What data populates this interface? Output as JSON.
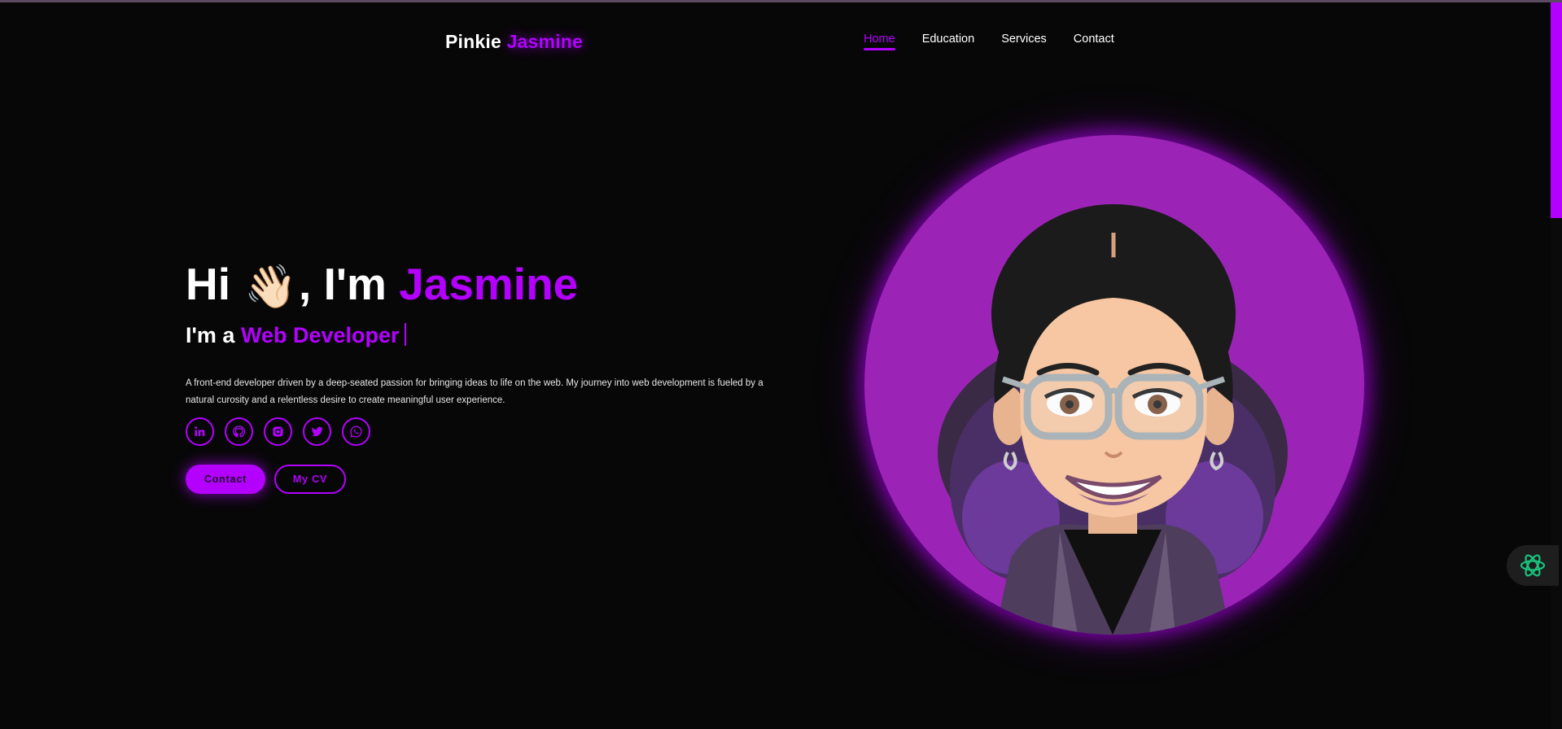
{
  "header": {
    "logo_first": "Pinkie",
    "logo_second": "Jasmine",
    "nav": [
      {
        "label": "Home"
      },
      {
        "label": "Education"
      },
      {
        "label": "Services"
      },
      {
        "label": "Contact"
      }
    ]
  },
  "hero": {
    "greeting_prefix": "Hi",
    "wave_emoji": "👋🏻",
    "greeting_middle": ", I'm",
    "name": "Jasmine",
    "role_prefix": "I'm a",
    "role": "Web Developer",
    "description": "A front-end developer driven by a deep-seated passion for bringing ideas to life on the web. My journey into web development is fueled by a natural curosity and a relentless desire to create meaningful user experience.",
    "socials": [
      {
        "icon": "linkedin-icon"
      },
      {
        "icon": "github-icon"
      },
      {
        "icon": "instagram-icon"
      },
      {
        "icon": "twitter-icon"
      },
      {
        "icon": "whatsapp-icon"
      }
    ],
    "contact_button": "Contact",
    "cv_button": "My CV"
  },
  "avatar": {
    "icon": "bitmoji-avatar"
  },
  "widget": {
    "icon": "chatgpt-icon"
  },
  "colors": {
    "accent": "#b300ff",
    "background": "#070707",
    "avatar_background": "#9b24b6"
  }
}
